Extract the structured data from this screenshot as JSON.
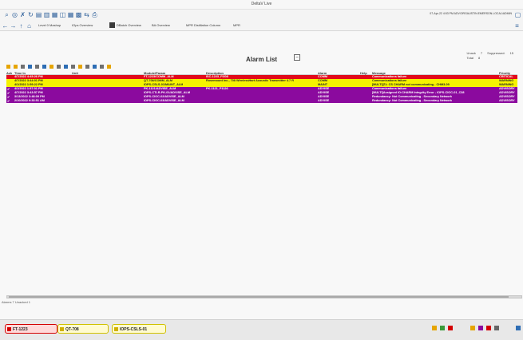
{
  "window": {
    "title": "DeltaV Live"
  },
  "toolbar": {
    "crumbs": [
      {
        "label": "Level 0 Mashup"
      },
      {
        "label": "IOps Overview"
      },
      {
        "label": "DBatch Overview"
      },
      {
        "label": "BA Overview"
      },
      {
        "label": "MPR Distillation Column"
      },
      {
        "label": "MPR"
      }
    ],
    "clock": "07-Apr-22 4:53 PM  ADV/ORGAUSTIN.EMERSON.LOCAL\\ADMIN"
  },
  "alarm_list": {
    "title": "Alarm List",
    "counts": {
      "unack_label": "Unack",
      "unack_value": "7",
      "total_label": "Total",
      "total_value": "8",
      "suppressed_label": "Suppressed:",
      "suppressed_value": "15"
    },
    "columns": {
      "ack": "Ack",
      "time": "Time In",
      "unit": "Unit",
      "module": "Module/Param",
      "description": "Description",
      "alarm": "Alarm",
      "help": "Help",
      "message": "Message",
      "priority": "Priority"
    },
    "rows": [
      {
        "ack": "",
        "time": "4/7/2022 4:45:26 PM",
        "unit": "",
        "module": "FT-1223/COMM_ALM",
        "description": "ISC-1223_FI308",
        "alarm": "COMM",
        "help": "",
        "message": "Communications failure",
        "priority": "CRITICAL",
        "bg": "#e10a1a",
        "fg": "#ffffff"
      },
      {
        "ack": "",
        "time": "4/7/2022 3:44:01 PM",
        "unit": "",
        "module": "QT-708/COMM_ALM",
        "description": "Rosemount Inc., 708 WirelessHart Acoustic Transmitter 4.7 R",
        "alarm": "COMM",
        "help": "",
        "message": "Communications failure",
        "priority": "WARNING",
        "bg": "#f5f200",
        "fg": "#222222"
      },
      {
        "ack": "",
        "time": "4/1/2022 1:59:22 PM",
        "unit": "",
        "module": "IOPS-CSLS-01/MAINT_ALM",
        "description": "",
        "alarm": "MAINT",
        "help": "",
        "message": "[MULTI]Z1: CS CHARM not communicating - CHM3-09",
        "priority": "WARNING",
        "bg": "#f5f200",
        "fg": "#222222"
      },
      {
        "ack": "✔",
        "time": "4/1/2022 1:57:01 PM",
        "unit": "",
        "module": "PK-1121/ADVISE_ALM",
        "description": "PK-1121_P1126",
        "alarm": "ADVISE",
        "help": "",
        "message": "Communications failure",
        "priority": "ADVISORY",
        "bg": "#8b0a9e",
        "fg": "#ffffff"
      },
      {
        "ack": "✔",
        "time": "4/7/2022 3:43:57 PM",
        "unit": "",
        "module": "IOPS-CTLR-PK-01/ADVISE_ALM",
        "description": "",
        "alarm": "ADVISE",
        "help": "",
        "message": "[MULTI]Assigned IO:CHARM Integrity Error - IOPS-CIOC-01_C38",
        "priority": "ADVISORY",
        "bg": "#8b0a9e",
        "fg": "#ffffff"
      },
      {
        "ack": "✔",
        "time": "3/13/2022 3:48:09 PM",
        "unit": "",
        "module": "IOPS-CIOC-02/ADVISE_ALM",
        "description": "",
        "alarm": "ADVISE",
        "help": "",
        "message": "Redundancy: Not Communicating - Secondary Network",
        "priority": "ADVISORY",
        "bg": "#8b0a9e",
        "fg": "#ffffff"
      },
      {
        "ack": "✔",
        "time": "2/10/2022 9:33:51 AM",
        "unit": "",
        "module": "IOPS-CIOC-03/ADVISE_ALM",
        "description": "",
        "alarm": "ADVISE",
        "help": "",
        "message": "Redundancy: Not Communicating - Secondary Network",
        "priority": "ADVISORY",
        "bg": "#8b0a9e",
        "fg": "#ffffff"
      }
    ],
    "status": "Alarms 7 Unacked 1"
  },
  "banners": [
    {
      "label": "FT-1223",
      "bg": "#ffd9d9",
      "border": "#d40000",
      "mark": "#d40000"
    },
    {
      "label": "QT-708",
      "bg": "#fffbd0",
      "border": "#d0c000",
      "mark": "#d0b000"
    },
    {
      "label": "IOPS-CSLS-01",
      "bg": "#fffbd0",
      "border": "#d0c000",
      "mark": "#d0b000"
    }
  ]
}
